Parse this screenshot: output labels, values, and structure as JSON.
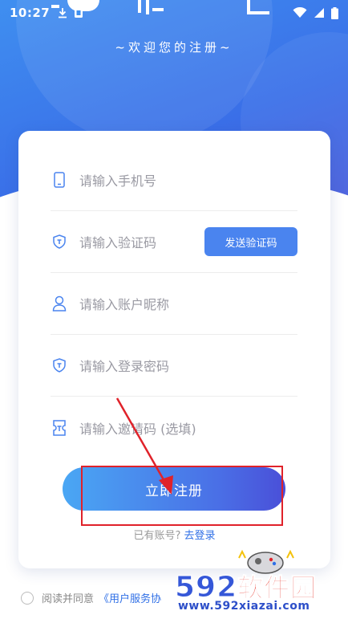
{
  "status_bar": {
    "time": "10:27"
  },
  "header": {
    "welcome": "~欢迎您的注册~"
  },
  "form": {
    "phone_placeholder": "请输入手机号",
    "code_placeholder": "请输入验证码",
    "send_code_label": "发送验证码",
    "nickname_placeholder": "请输入账户昵称",
    "password_placeholder": "请输入登录密码",
    "invite_placeholder": "请输入邀请码 (选填)",
    "register_label": "立即注册",
    "have_account": "已有账号?",
    "login_link": "去登录"
  },
  "agreement": {
    "prefix": "阅读并同意",
    "link": "《用户服务协"
  },
  "watermark": {
    "brand_num": "592",
    "brand_cn": "软件园",
    "url": "www.592xiazai.com"
  },
  "colors": {
    "primary": "#4a84ef",
    "link": "#2f6fe6",
    "annotation": "#e0222a"
  }
}
